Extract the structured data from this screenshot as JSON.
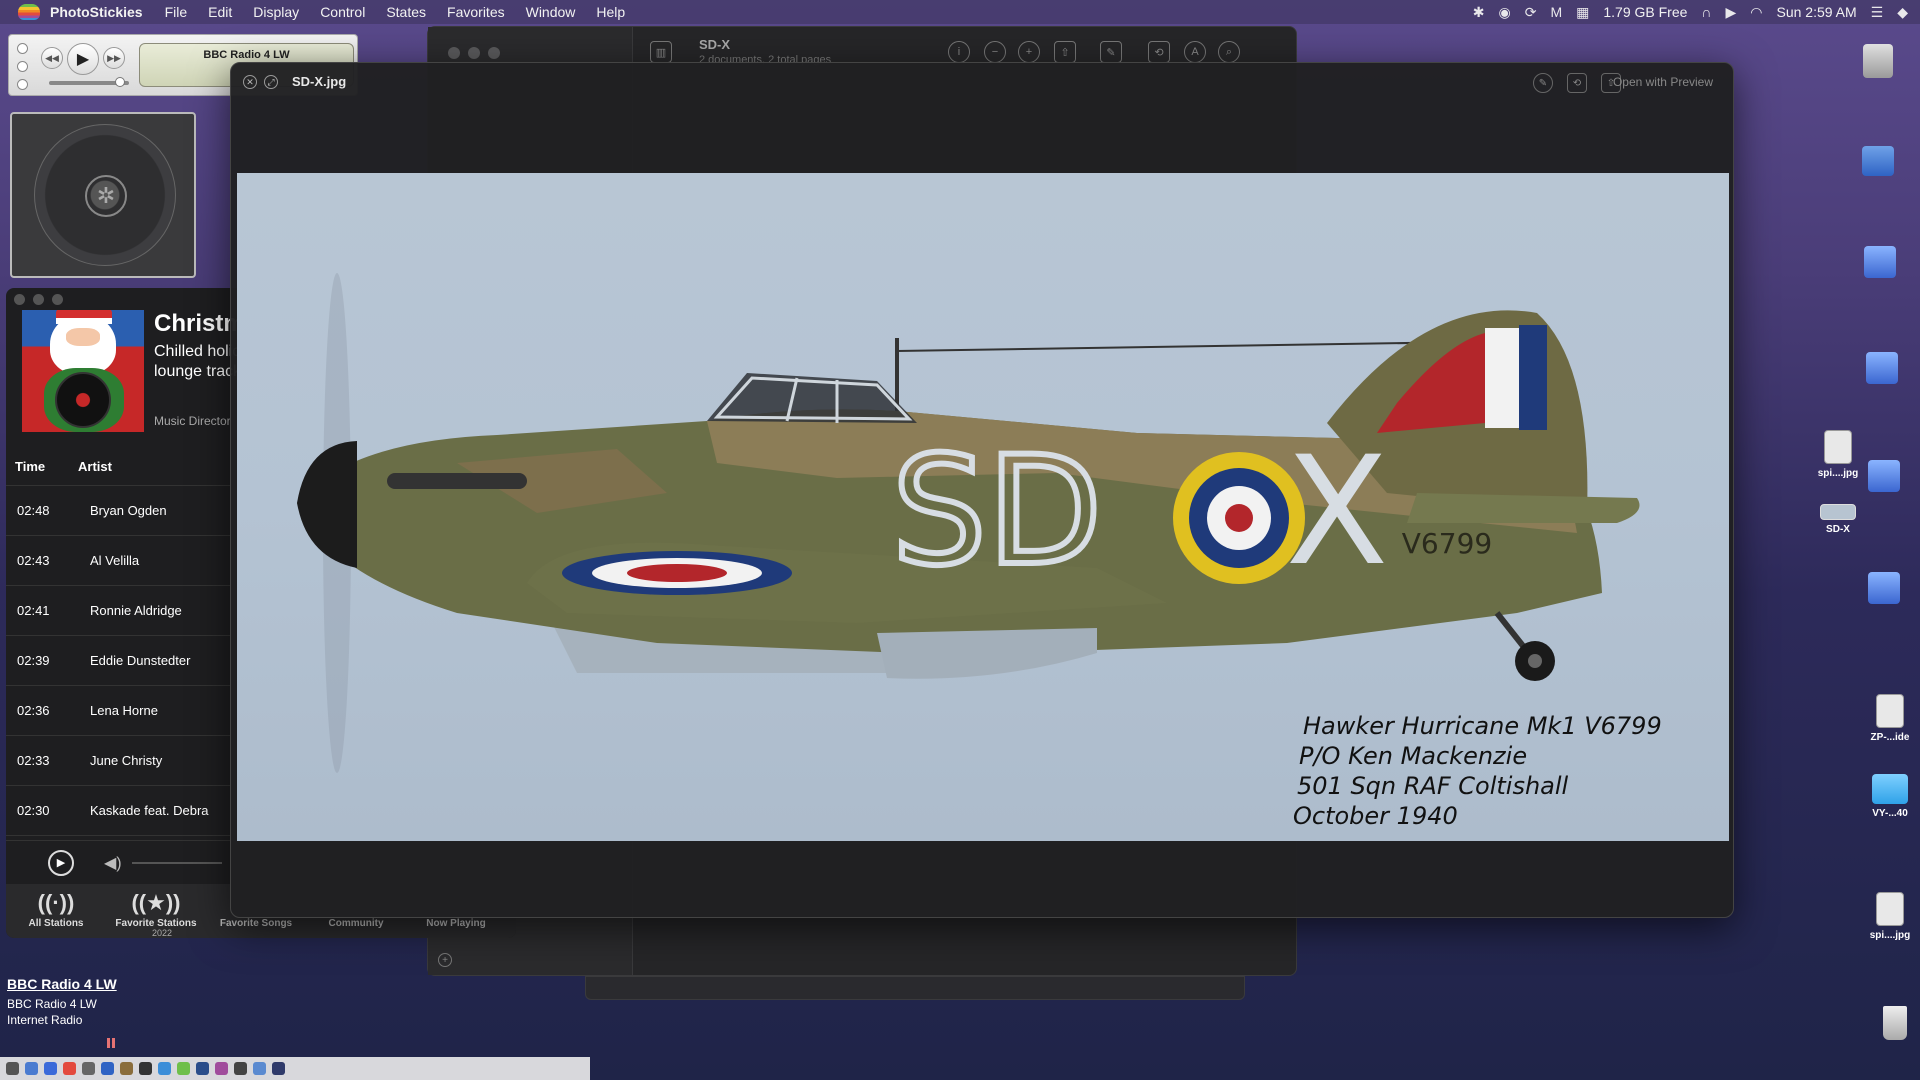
{
  "menubar": {
    "app_name": "PhotoStickies",
    "menus": [
      "File",
      "Edit",
      "Display",
      "Control",
      "States",
      "Favorites",
      "Window",
      "Help"
    ],
    "status": {
      "memory": "1.79 GB Free",
      "clock": "Sun 2:59 AM",
      "icons": [
        "bluetooth-icon",
        "record-icon",
        "sync-icon",
        "malwarebytes-icon",
        "memory-chip-icon",
        "headphones-icon",
        "play-circle-icon",
        "wifi-icon",
        "control-center-icon",
        "siri-icon"
      ]
    }
  },
  "mini_player": {
    "station": "BBC Radio 4 LW"
  },
  "music_window": {
    "playlist_title": "Christm",
    "playlist_desc_line1": "Chilled holic",
    "playlist_desc_line2": "lounge track",
    "playlist_source": "Music Director",
    "columns": {
      "time": "Time",
      "artist": "Artist"
    },
    "rows": [
      {
        "time": "02:48",
        "artist": "Bryan Ogden"
      },
      {
        "time": "02:43",
        "artist": "Al Velilla"
      },
      {
        "time": "02:41",
        "artist": "Ronnie Aldridge"
      },
      {
        "time": "02:39",
        "artist": "Eddie Dunstedter"
      },
      {
        "time": "02:36",
        "artist": "Lena Horne"
      },
      {
        "time": "02:33",
        "artist": "June Christy"
      },
      {
        "time": "02:30",
        "artist": "Kaskade feat. Debra"
      }
    ],
    "nav": {
      "all_stations": "All Stations",
      "favorite_stations": "Favorite Stations",
      "favorite_songs": "Favorite Songs",
      "community": "Community",
      "now_playing": "Now Playing"
    },
    "year": "2022"
  },
  "station_info": {
    "name": "BBC Radio 4 LW",
    "line1": "BBC Radio 4 LW",
    "line2": "Internet Radio"
  },
  "preview_window": {
    "doc_title": "SD-X",
    "doc_sub": "2 documents, 2 total pages"
  },
  "quicklook": {
    "title": "SD-X.jpg",
    "open_with": "Open with Preview",
    "image": {
      "fuselage_code": "SD",
      "fuselage_letter": "X",
      "serial": "V6799",
      "caption_lines": [
        "Hawker Hurricane Mk1 V6799",
        "P/O Ken Mackenzie",
        "501 Sqn RAF Coltishall",
        "October 1940"
      ]
    }
  },
  "desktop_icons": [
    {
      "label": "spi....jpg"
    },
    {
      "label": "SD-X"
    },
    {
      "label": "ZP-...ide"
    },
    {
      "label": "VY-...40"
    },
    {
      "label": "spi....jpg"
    }
  ],
  "colors": {
    "roundel_blue": "#1f3a7a",
    "roundel_yellow": "#e0c020",
    "roundel_red": "#b3262b",
    "camo_green": "#5f6a44",
    "camo_brown": "#8a7a55",
    "sky": "#b5c4d3"
  }
}
